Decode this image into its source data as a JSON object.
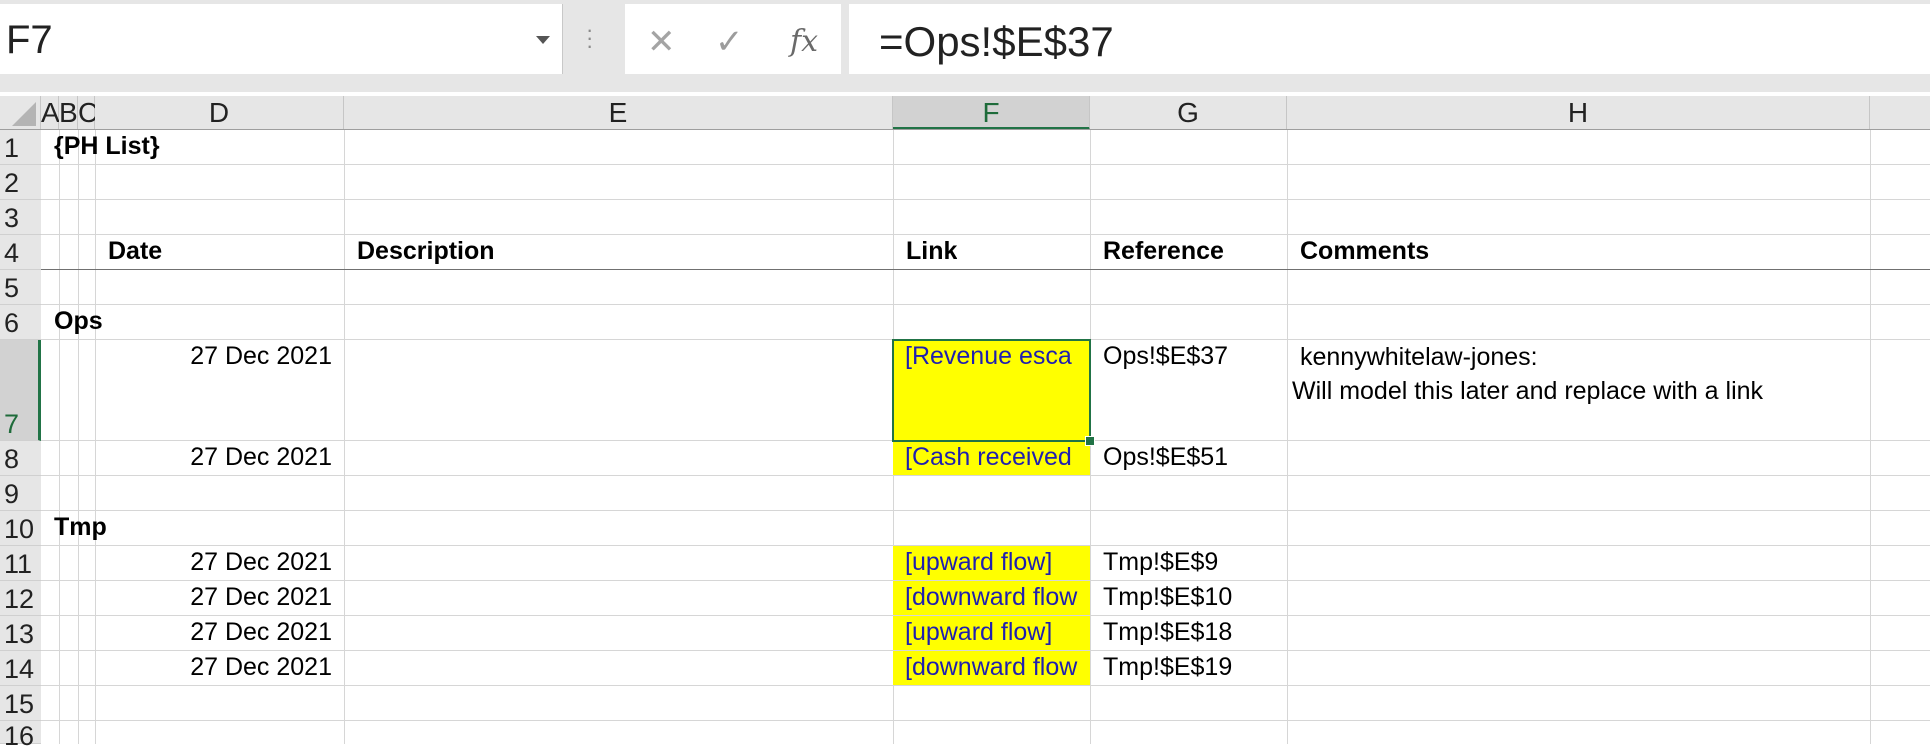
{
  "formula_bar": {
    "name_box": "F7",
    "formula": "=Ops!$E$37",
    "cancel_icon": "✕",
    "enter_icon": "✓",
    "fx_icon": "fx"
  },
  "columns": [
    "A",
    "B",
    "C",
    "D",
    "E",
    "F",
    "G",
    "H"
  ],
  "rows": [
    "1",
    "2",
    "3",
    "4",
    "5",
    "6",
    "7",
    "8",
    "9",
    "10",
    "11",
    "12",
    "13",
    "14",
    "15",
    "16"
  ],
  "sheet": {
    "title": "{PH List}",
    "headers": {
      "date": "Date",
      "description": "Description",
      "link": "Link",
      "reference": "Reference",
      "comments": "Comments"
    },
    "sections": [
      {
        "name": "Ops"
      },
      {
        "name": "Tmp"
      }
    ],
    "entries": [
      {
        "date": "27 Dec 2021",
        "link": "[Revenue esca",
        "reference": "Ops!$E$37"
      },
      {
        "date": "27 Dec 2021",
        "link": "[Cash received",
        "reference": "Ops!$E$51"
      },
      {
        "date": "27 Dec 2021",
        "link": "[upward flow]",
        "reference": "Tmp!$E$9"
      },
      {
        "date": "27 Dec 2021",
        "link": "[downward flow",
        "reference": "Tmp!$E$10"
      },
      {
        "date": "27 Dec 2021",
        "link": "[upward flow]",
        "reference": "Tmp!$E$18"
      },
      {
        "date": "27 Dec 2021",
        "link": "[downward flow",
        "reference": "Tmp!$E$19"
      }
    ],
    "comment": {
      "author": "kennywhitelaw-jones:",
      "text": "Will model this later and replace with a link"
    }
  },
  "colors": {
    "highlight": "#ffff00",
    "link_text": "#1f1fb0",
    "selection": "#217346"
  }
}
